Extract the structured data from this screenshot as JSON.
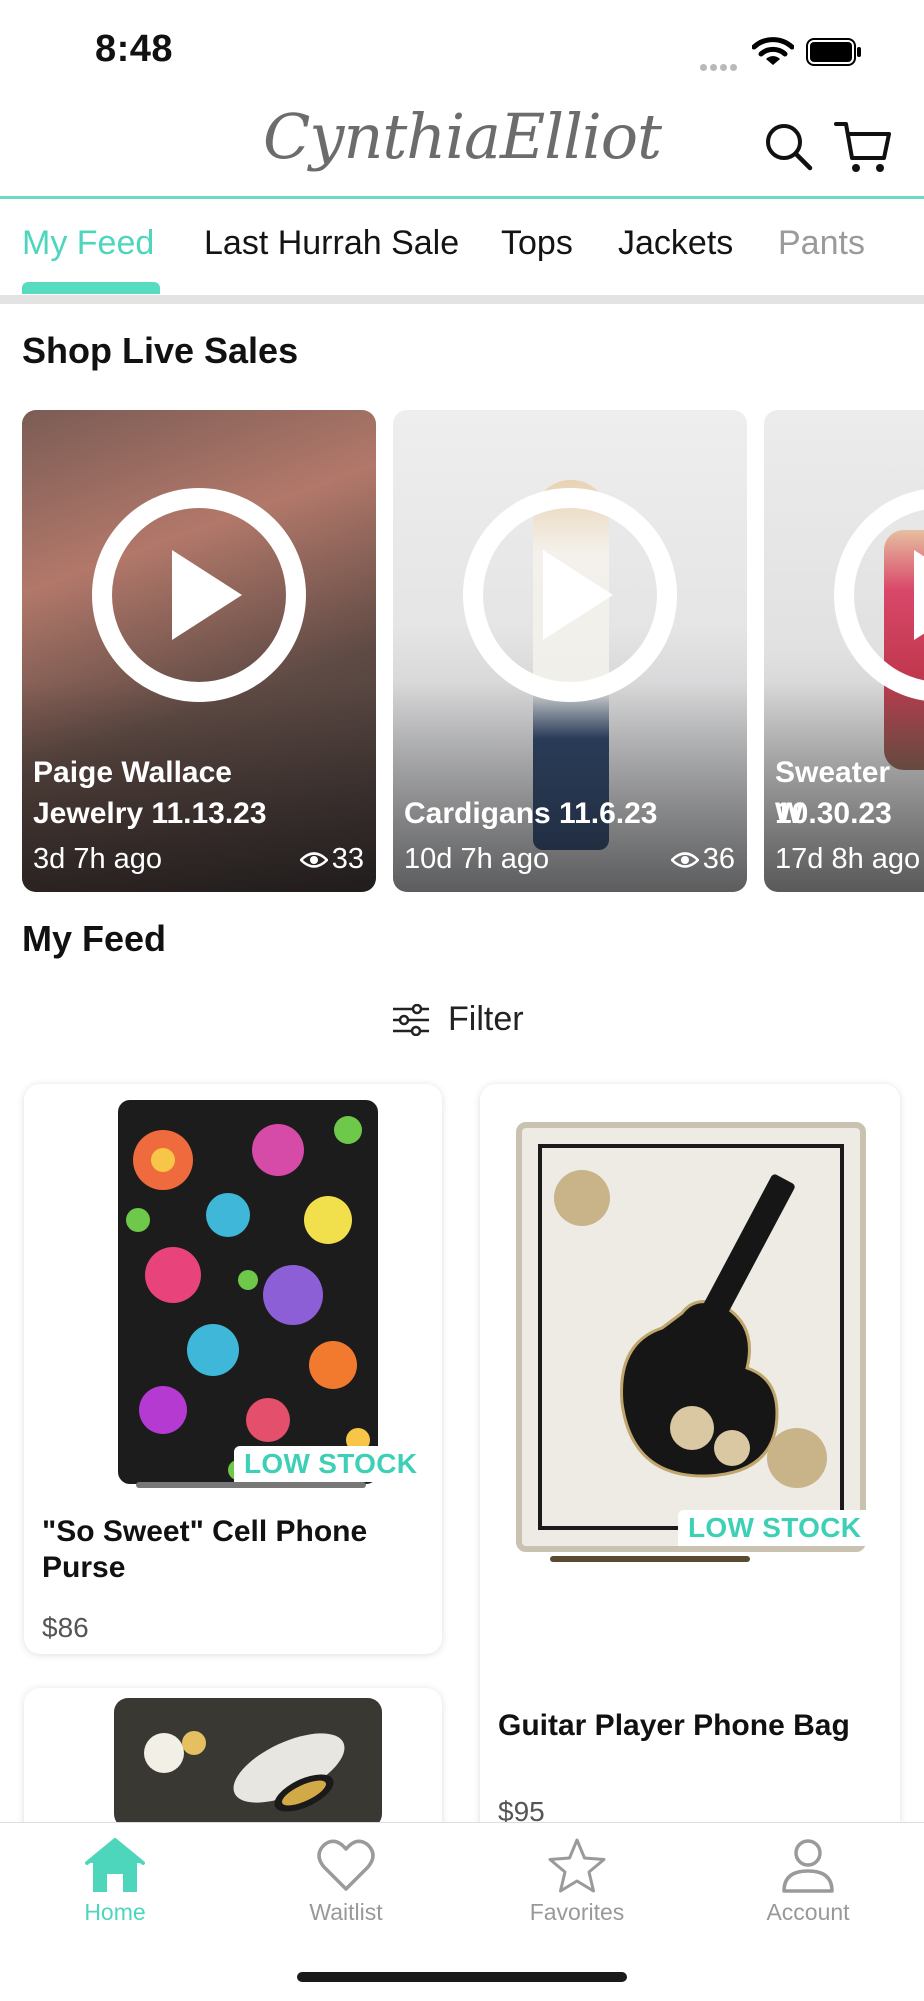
{
  "status_bar": {
    "time": "8:48"
  },
  "header": {
    "logo": "CynthiaElliot"
  },
  "tabs": [
    {
      "label": "My Feed",
      "active": true
    },
    {
      "label": "Last Hurrah Sale"
    },
    {
      "label": "Tops"
    },
    {
      "label": "Jackets"
    },
    {
      "label": "Pants"
    }
  ],
  "live_section": {
    "title": "Shop Live Sales",
    "cards": [
      {
        "title_line1": "Paige Wallace",
        "title_line2": "Jewelry 11.13.23",
        "ago": "3d 7h ago",
        "views": "33"
      },
      {
        "title_line1": "",
        "title_line2": "Cardigans 11.6.23",
        "ago": "10d 7h ago",
        "views": "36"
      },
      {
        "title_line1": "Sweater W",
        "title_line2": "10.30.23",
        "ago": "17d 8h ago",
        "views": ""
      }
    ]
  },
  "feed": {
    "title": "My Feed",
    "filter_label": "Filter",
    "products": [
      {
        "name": "\"So Sweet\" Cell Phone Purse",
        "price": "$86",
        "badge": "LOW STOCK"
      },
      {
        "name": "Guitar Player Phone Bag",
        "price": "$95",
        "badge": "LOW STOCK"
      }
    ]
  },
  "bottom_nav": [
    {
      "label": "Home",
      "active": true
    },
    {
      "label": "Waitlist"
    },
    {
      "label": "Favorites"
    },
    {
      "label": "Account"
    }
  ],
  "colors": {
    "accent": "#4ed6bd",
    "muted": "#999999"
  }
}
